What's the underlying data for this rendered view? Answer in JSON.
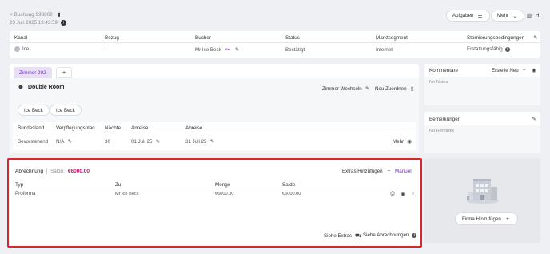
{
  "header": {
    "back_link": "< Buchung 993802",
    "date": "23 Jun 2025 19:43:59",
    "buttons": {
      "tasks": "Aufgaben",
      "more": "Mehr"
    },
    "user_initials": "HI"
  },
  "overview": {
    "columns": [
      "Kanal",
      "Bezug",
      "Bucher",
      "Status",
      "Marktsegment",
      "Stornierungsbedingungen"
    ],
    "values": {
      "channel": "Ice",
      "reference": "-",
      "booker": "Mr Ice Beck",
      "status": "Bestätigt",
      "segment": "Internet",
      "cancellation": "Erstattungsfähig"
    }
  },
  "rooms": {
    "tab_active": "Zimmer 202",
    "tab_add": "+",
    "room_type": "Double Room",
    "change_room": "Zimmer Wechseln",
    "reassign": "Neu Zuordnen",
    "guests": [
      "Ice Beck",
      "Ice Beck"
    ],
    "table_headers": [
      "Bundesland",
      "Verpflegungsplan",
      "Nächte",
      "Anreise",
      "Abreise"
    ],
    "table_row": {
      "state": "Bevorstehend",
      "meal_plan": "N/A",
      "nights": "30",
      "arrival": "01 Juli 25",
      "departure": "31 Juli 25"
    },
    "more": "Mehr"
  },
  "billing": {
    "title": "Abrechnung",
    "saldo_label": "Saldo:",
    "saldo_value": "€6000.00",
    "add_extras": "Extras Hinzufügen",
    "manual": "Manuell",
    "headers": [
      "Typ",
      "Zu",
      "Menge",
      "Saldo"
    ],
    "row": {
      "type": "Proforma",
      "to": "Mr Ice Beck",
      "amount": "€6000.00",
      "balance": "€6000.00"
    },
    "see_extras": "Siehe Extras",
    "see_bills": "Siehe Abrechnungen"
  },
  "comments": {
    "title": "Kommentare",
    "create": "Erstelle Neu",
    "empty": "No Notes"
  },
  "remarks": {
    "title": "Bemerkungen",
    "empty": "No Remarks"
  },
  "company": {
    "add": "Firma Hinzufügen"
  },
  "colors": {
    "accent": "#7a2fc4",
    "saldo": "#c2126f",
    "highlight": "#d7262c",
    "tab_bg": "#e7e0f5"
  }
}
